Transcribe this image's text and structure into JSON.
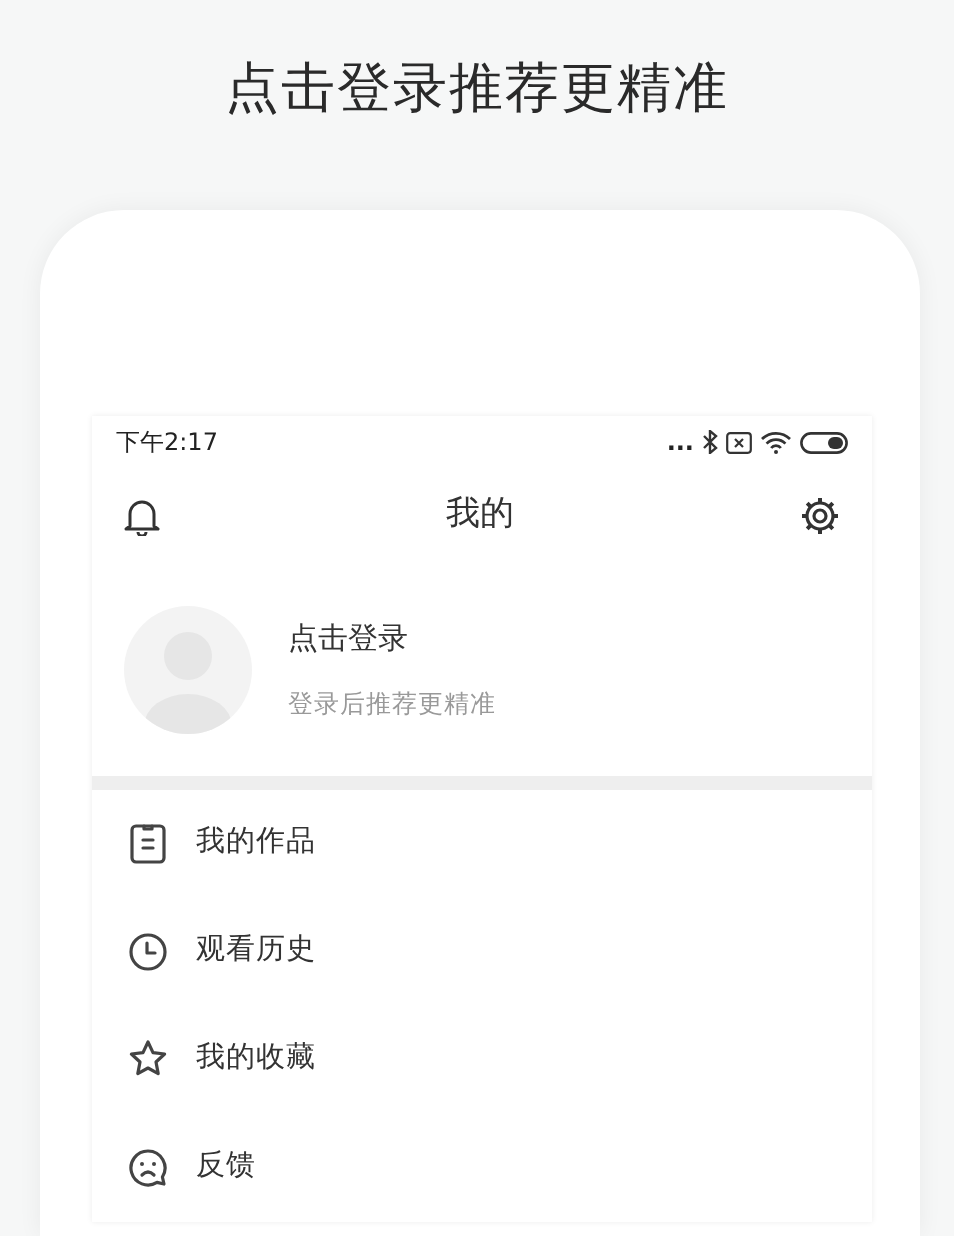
{
  "headline": "点击登录推荐更精准",
  "status_bar": {
    "time": "下午2:17",
    "dots": "..."
  },
  "header": {
    "title": "我的"
  },
  "profile": {
    "name": "点击登录",
    "subtitle": "登录后推荐更精准"
  },
  "menu": [
    {
      "label": "我的作品"
    },
    {
      "label": "观看历史"
    },
    {
      "label": "我的收藏"
    },
    {
      "label": "反馈"
    }
  ]
}
